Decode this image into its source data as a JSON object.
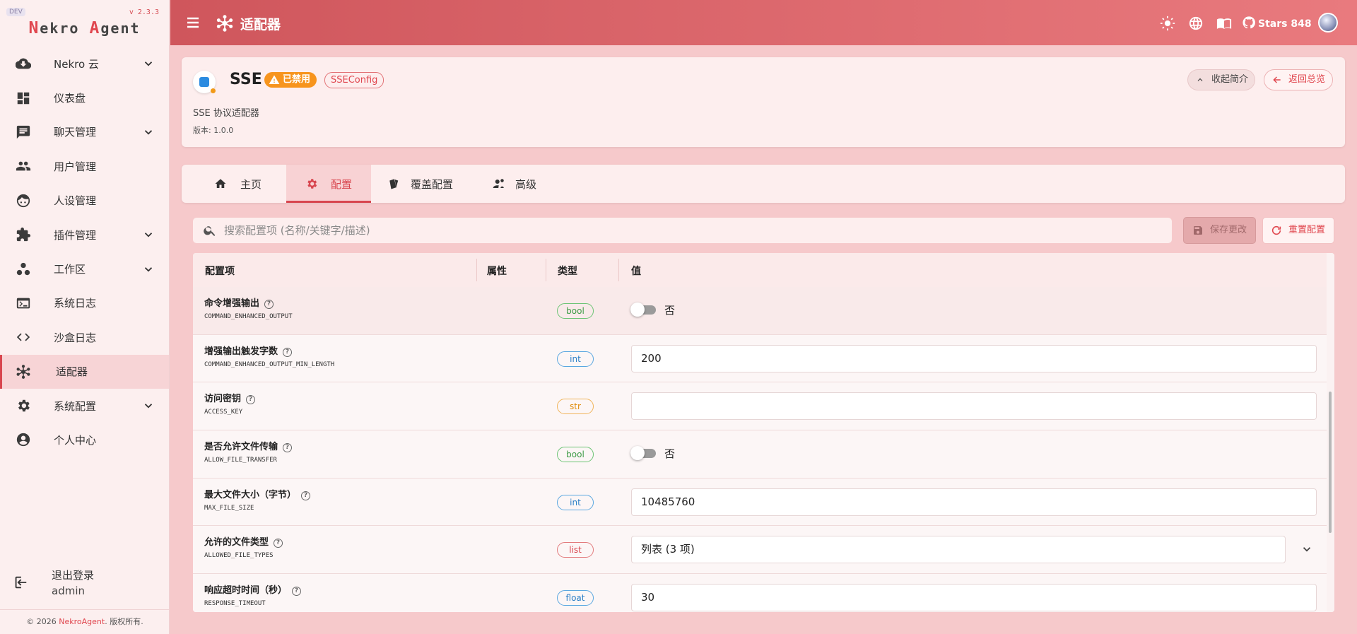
{
  "sidebar": {
    "dev_badge": "DEV",
    "version": "v 2.3.3",
    "brand_n": "N",
    "brand_ekro": "ekro ",
    "brand_a": "A",
    "brand_gent": "gent",
    "items": [
      {
        "label": "Nekro 云",
        "icon": "cloud-download-icon",
        "expandable": true
      },
      {
        "label": "仪表盘",
        "icon": "dashboard-icon",
        "expandable": false
      },
      {
        "label": "聊天管理",
        "icon": "chat-icon",
        "expandable": true
      },
      {
        "label": "用户管理",
        "icon": "users-icon",
        "expandable": false
      },
      {
        "label": "人设管理",
        "icon": "face-icon",
        "expandable": false
      },
      {
        "label": "插件管理",
        "icon": "puzzle-icon",
        "expandable": true
      },
      {
        "label": "工作区",
        "icon": "workspace-icon",
        "expandable": true
      },
      {
        "label": "系统日志",
        "icon": "terminal-icon",
        "expandable": false
      },
      {
        "label": "沙盒日志",
        "icon": "code-icon",
        "expandable": false
      },
      {
        "label": "适配器",
        "icon": "hub-icon",
        "expandable": false,
        "active": true
      },
      {
        "label": "系统配置",
        "icon": "gear-icon",
        "expandable": true
      },
      {
        "label": "个人中心",
        "icon": "account-icon",
        "expandable": false
      }
    ],
    "logout_label": "退出登录",
    "username": "admin",
    "footer_prefix": "© 2026 ",
    "footer_brand": "NekroAgent",
    "footer_suffix": ". 版权所有."
  },
  "topbar": {
    "title": "适配器",
    "stars_label": "Stars 848",
    "accent_color": "#d8464f"
  },
  "adapter": {
    "name": "SSE",
    "status_badge": "已禁用",
    "config_badge": "SSEConfig",
    "description": "SSE 协议适配器",
    "version": "版本: 1.0.0",
    "collapse_label": "收起简介",
    "back_label": "返回总览"
  },
  "tabs": [
    {
      "label": "主页",
      "icon": "home-icon"
    },
    {
      "label": "配置",
      "icon": "gear-icon",
      "active": true
    },
    {
      "label": "覆盖配置",
      "icon": "layers-icon"
    },
    {
      "label": "高级",
      "icon": "user-gear-icon"
    }
  ],
  "search": {
    "placeholder": "搜索配置项 (名称/关键字/描述)",
    "value": ""
  },
  "actions": {
    "save_label": "保存更改",
    "reset_label": "重置配置"
  },
  "table": {
    "headers": [
      "配置项",
      "属性",
      "类型",
      "值"
    ],
    "rows": [
      {
        "name": "命令增强输出",
        "key": "COMMAND_ENHANCED_OUTPUT",
        "type": "bool",
        "value": "否"
      },
      {
        "name": "增强输出触发字数",
        "key": "COMMAND_ENHANCED_OUTPUT_MIN_LENGTH",
        "type": "int",
        "value": "200"
      },
      {
        "name": "访问密钥",
        "key": "ACCESS_KEY",
        "type": "str",
        "value": ""
      },
      {
        "name": "是否允许文件传输",
        "key": "ALLOW_FILE_TRANSFER",
        "type": "bool",
        "value": "否"
      },
      {
        "name": "最大文件大小（字节）",
        "key": "MAX_FILE_SIZE",
        "type": "int",
        "value": "10485760"
      },
      {
        "name": "允许的文件类型",
        "key": "ALLOWED_FILE_TYPES",
        "type": "list",
        "value": "列表 (3 项)"
      },
      {
        "name": "响应超时时间（秒）",
        "key": "RESPONSE_TIMEOUT",
        "type": "float",
        "value": "30"
      }
    ]
  }
}
